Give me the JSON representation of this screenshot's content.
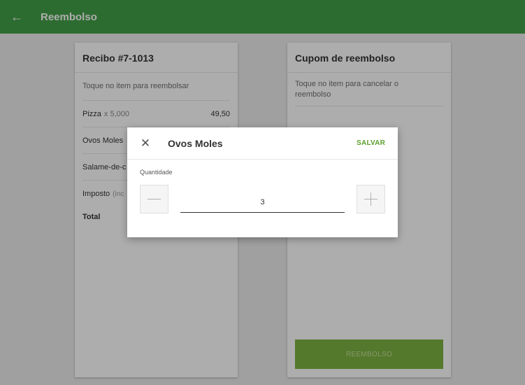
{
  "appbar": {
    "title": "Reembolso",
    "back_icon": "arrow-left-icon",
    "color": "#43a047"
  },
  "receipt": {
    "title": "Recibo #7-1013",
    "hint": "Toque no item para reembolsar",
    "items": [
      {
        "name": "Pizza",
        "qty": "x 5,000",
        "amount": "49,50"
      },
      {
        "name": "Ovos Moles",
        "qty": "",
        "amount": ""
      },
      {
        "name": "Salame-de-c",
        "qty": "",
        "amount": ""
      }
    ],
    "tax": {
      "label": "Imposto",
      "note": "(inc"
    },
    "total": {
      "label": "Total"
    }
  },
  "coupon": {
    "title": "Cupom de reembolso",
    "hint": "Toque no item para cancelar o reembolso",
    "refund_button": "REEMBOLSO",
    "button_color": "#7cb342"
  },
  "dialog": {
    "close_icon": "close-icon",
    "title": "Ovos Moles",
    "save_label": "SALVAR",
    "quantity_label": "Quantidade",
    "quantity_value": "3",
    "minus_icon": "minus-icon",
    "plus_icon": "plus-icon"
  }
}
